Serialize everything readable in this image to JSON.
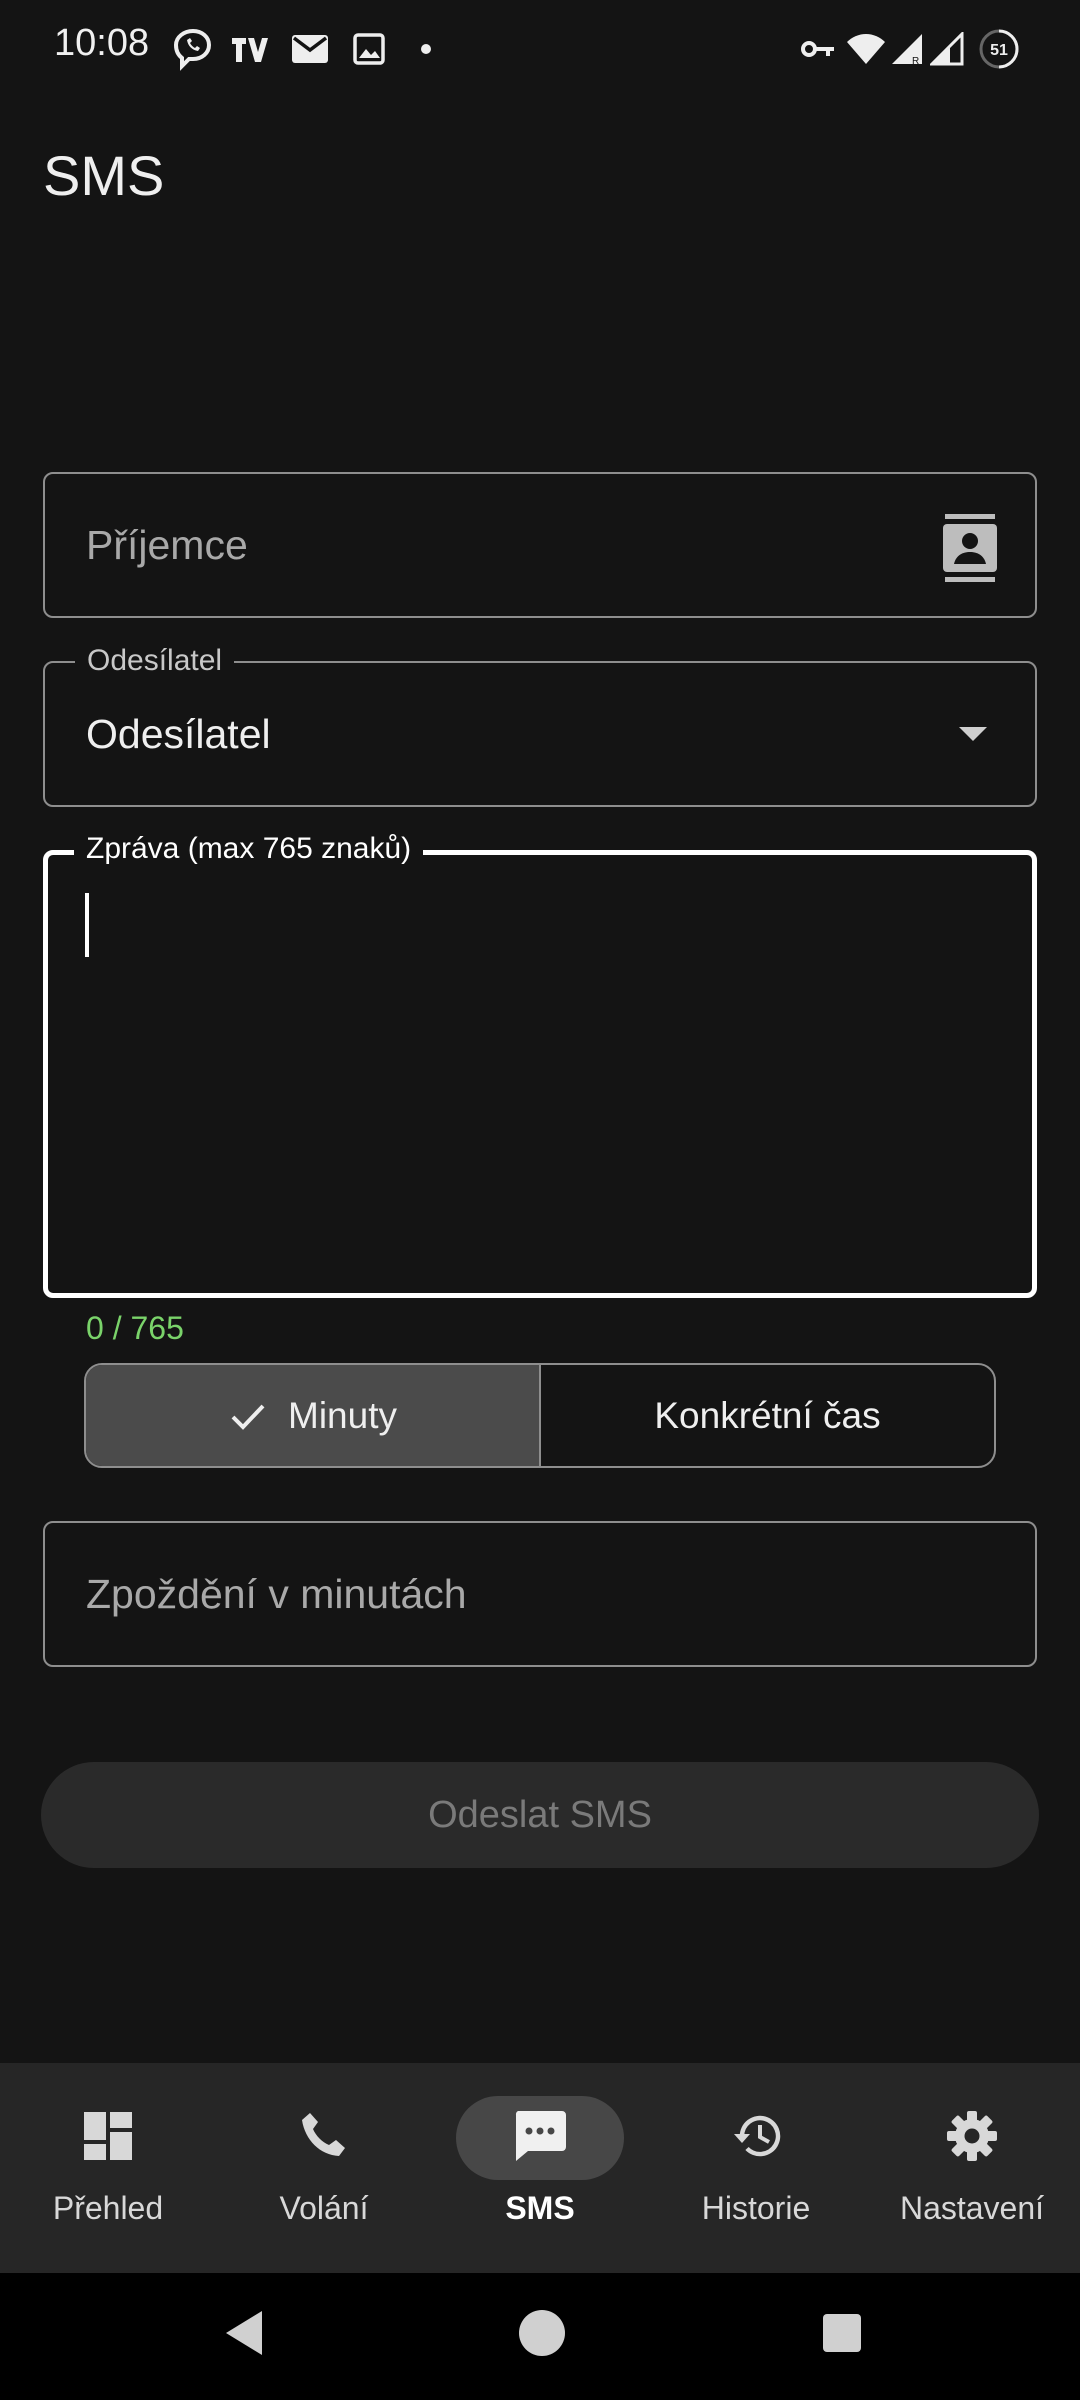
{
  "status_bar": {
    "time": "10:08",
    "left_icons": [
      "viber-icon",
      "tv-icon",
      "mail-icon",
      "image-icon",
      "dot-icon"
    ],
    "right_icons": [
      "vpn-key-icon",
      "wifi-icon",
      "signal-icon",
      "signal-icon",
      "battery-icon"
    ],
    "battery_level": "51"
  },
  "app": {
    "title": "SMS"
  },
  "form": {
    "recipient": {
      "placeholder": "Příjemce",
      "value": ""
    },
    "sender": {
      "label": "Odesílatel",
      "value": "Odesílatel"
    },
    "message": {
      "label": "Zpráva (max 765 znaků)",
      "value": ""
    },
    "counter": "0 / 765",
    "mode": {
      "options": [
        "Minuty",
        "Konkrétní čas"
      ],
      "selected": "Minuty"
    },
    "delay": {
      "placeholder": "Zpoždění v minutách",
      "value": ""
    },
    "send_label": "Odeslat SMS"
  },
  "nav": {
    "items": [
      {
        "label": "Přehled",
        "icon": "dashboard-icon"
      },
      {
        "label": "Volání",
        "icon": "phone-icon"
      },
      {
        "label": "SMS",
        "icon": "sms-icon"
      },
      {
        "label": "Historie",
        "icon": "history-icon"
      },
      {
        "label": "Nastavení",
        "icon": "settings-icon"
      }
    ],
    "active": "SMS"
  },
  "colors": {
    "background": "#141414",
    "counter_green": "#7ad36a",
    "nav_background": "#262626",
    "selected_segment": "#4b4b4b"
  }
}
